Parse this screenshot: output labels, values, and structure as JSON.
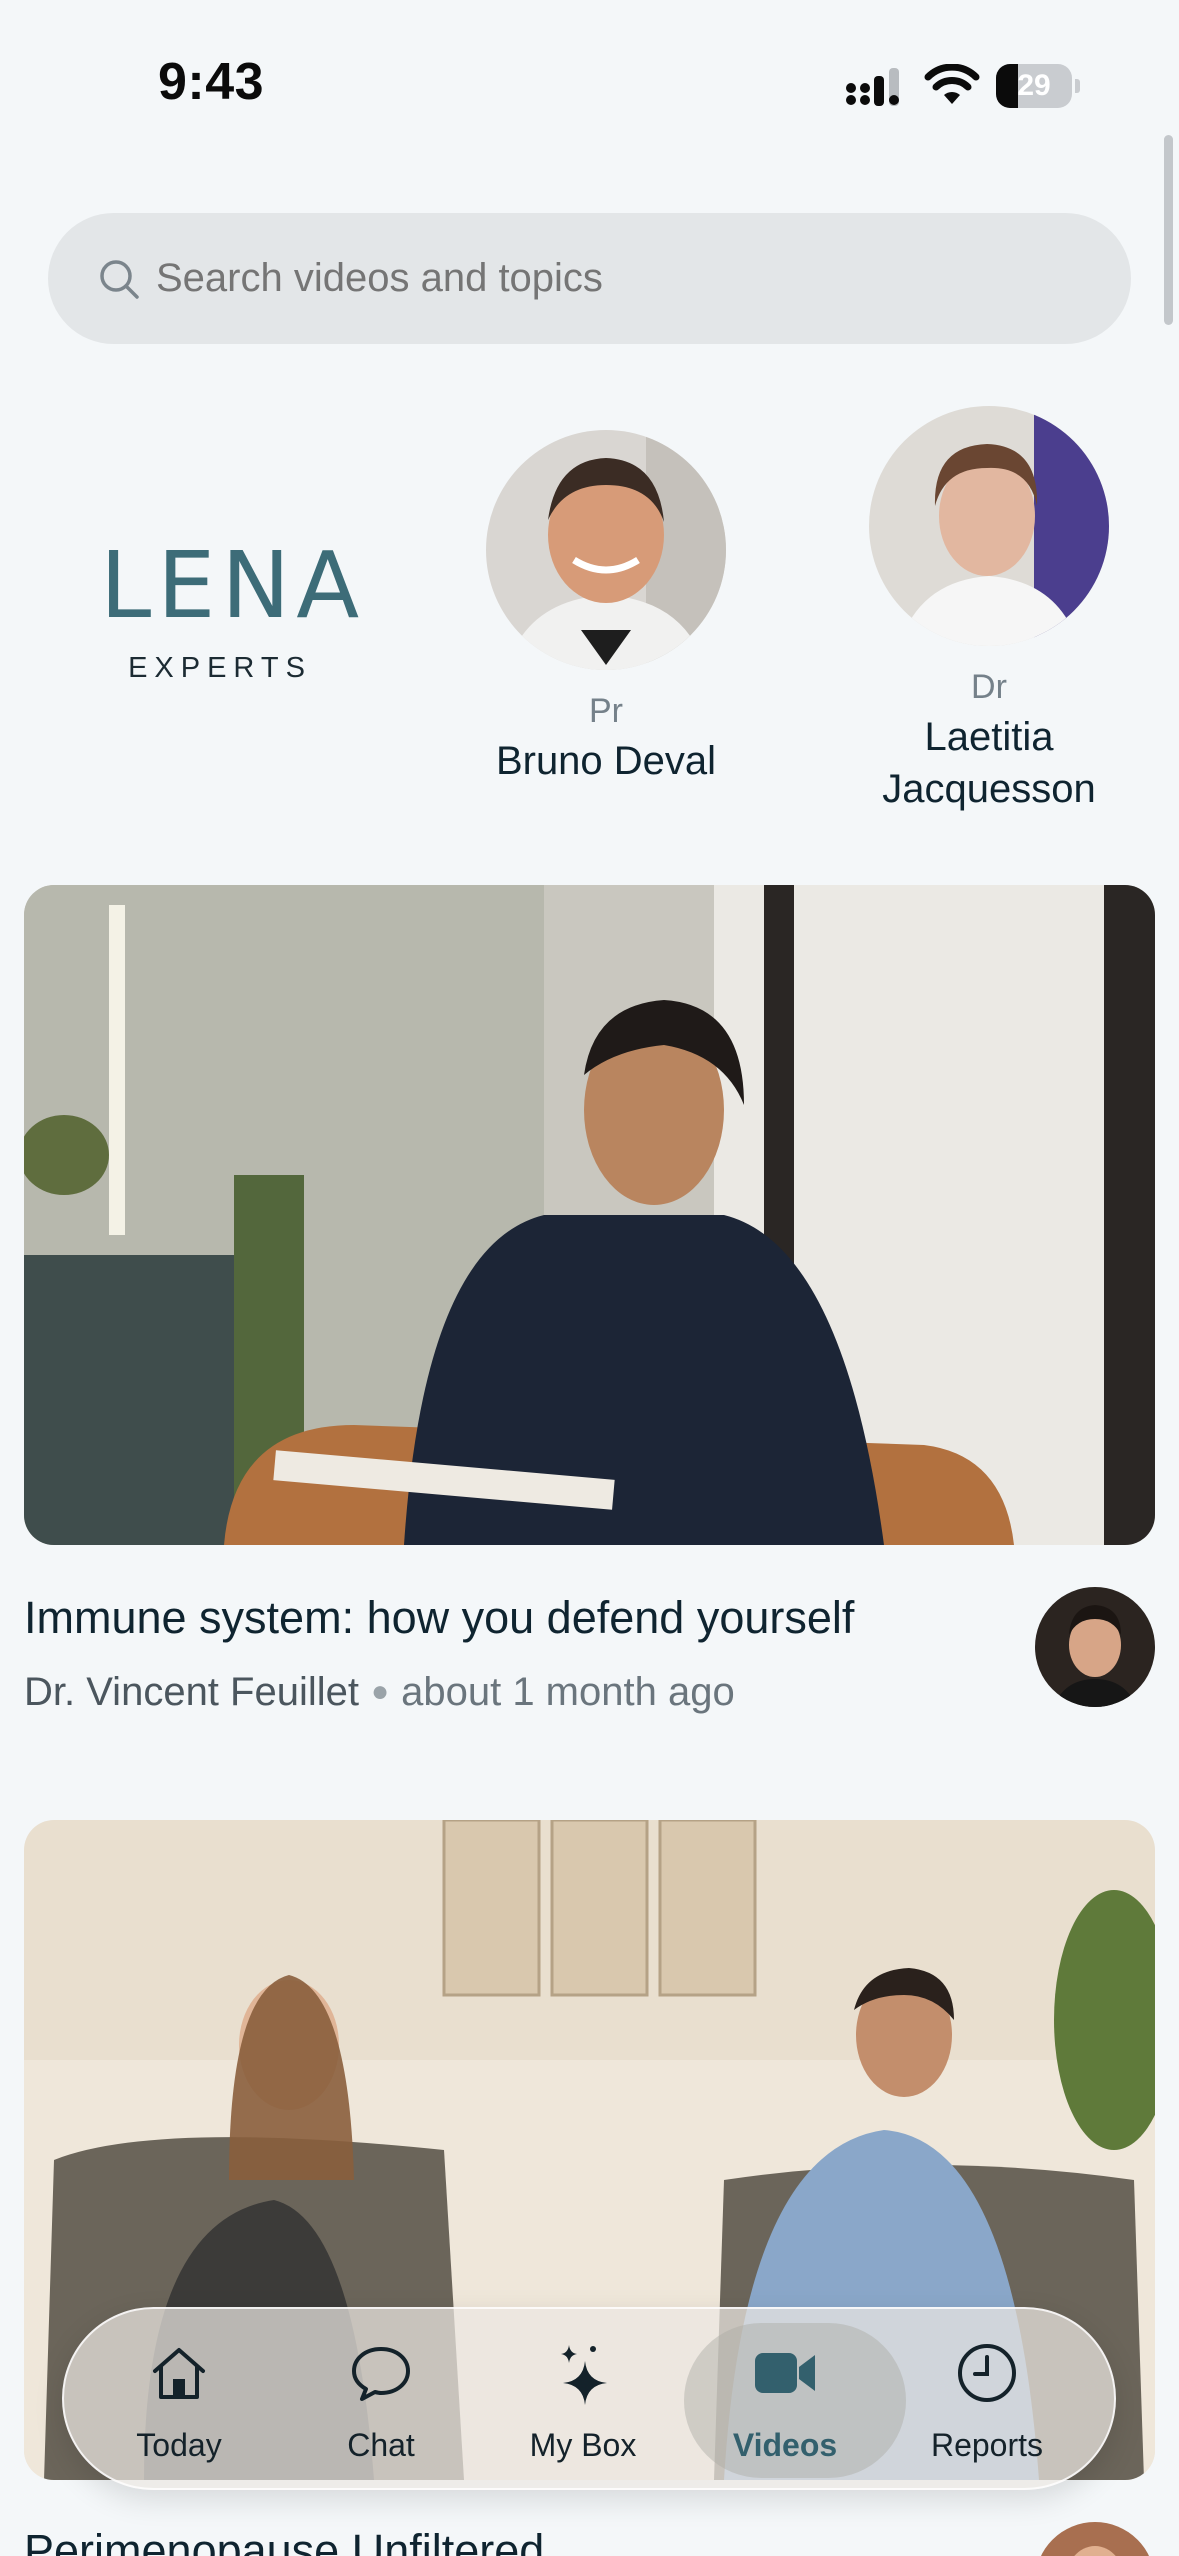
{
  "status_bar": {
    "time": "9:43",
    "battery_level": "29",
    "battery_fraction": 0.29
  },
  "search": {
    "placeholder": "Search videos and topics"
  },
  "experts": {
    "logo_word": "LENA",
    "logo_sub": "EXPERTS",
    "items": [
      {
        "title": "Pr",
        "name": "Bruno Deval"
      },
      {
        "title": "Dr",
        "name": "Laetitia Jacquesson"
      }
    ]
  },
  "videos": [
    {
      "title": "Immune system: how you defend yourself",
      "author": "Dr. Vincent Feuillet",
      "time_ago": "about 1 month ago"
    },
    {
      "title": "Perimenopause Unfiltered",
      "author": "",
      "time_ago": ""
    }
  ],
  "tab_bar": {
    "tabs": [
      {
        "label": "Today",
        "icon": "home-icon"
      },
      {
        "label": "Chat",
        "icon": "chat-bubble-icon"
      },
      {
        "label": "My Box",
        "icon": "sparkles-icon"
      },
      {
        "label": "Videos",
        "icon": "video-camera-icon"
      },
      {
        "label": "Reports",
        "icon": "clock-icon"
      }
    ],
    "active": "Videos",
    "active_color": "#33606d"
  }
}
